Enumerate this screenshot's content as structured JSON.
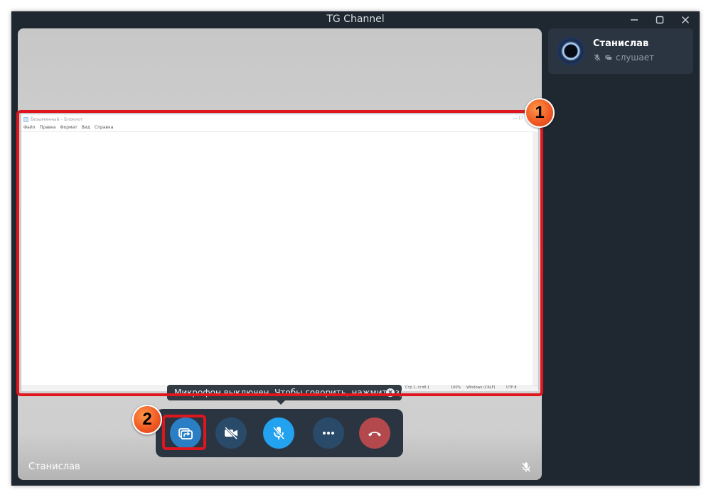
{
  "window": {
    "title": "TG Channel"
  },
  "shared_window": {
    "title": "Безымянный – Блокнот",
    "menu": [
      "Файл",
      "Правка",
      "Формат",
      "Вид",
      "Справка"
    ],
    "status": [
      "Стр 1, стлб 1",
      "100%",
      "Windows (CRLF)",
      "UTF-8"
    ]
  },
  "tooltip": {
    "text": "Микрофон выключен. Чтобы говорить, нажмите здесь."
  },
  "controls": {
    "items": [
      {
        "name": "screen-share-button",
        "icon": "screen-share-icon",
        "color": "#2a7fc4"
      },
      {
        "name": "camera-button",
        "icon": "video-off-icon",
        "color": "#2a4a6a"
      },
      {
        "name": "microphone-button",
        "icon": "mic-off-icon",
        "color": "#23a2f0"
      },
      {
        "name": "more-button",
        "icon": "more-icon",
        "color": "#2a4a6a"
      },
      {
        "name": "end-call-button",
        "icon": "hangup-icon",
        "color": "#b3494c"
      }
    ]
  },
  "video": {
    "participant_name": "Станислав"
  },
  "participant": {
    "name": "Станислав",
    "status": "слушает"
  },
  "annotations": {
    "badge_1": "1",
    "badge_2": "2",
    "highlight_color": "#e0161f"
  }
}
